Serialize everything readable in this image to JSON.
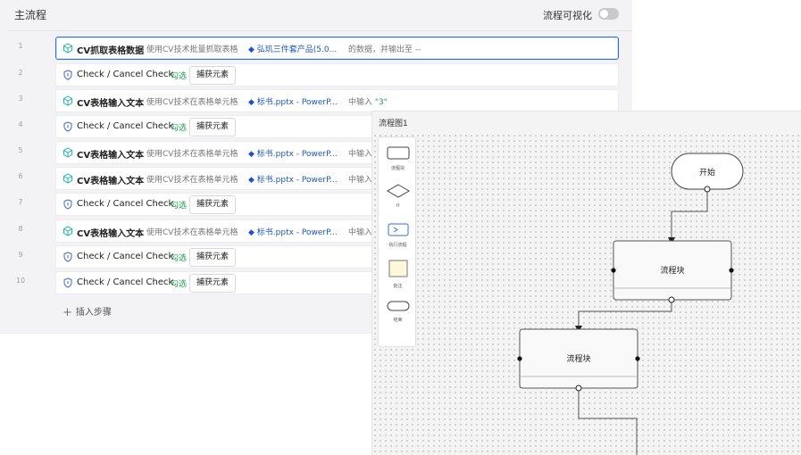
{
  "main": {
    "title": "主流程",
    "visualize_label": "流程可视化",
    "visualize_on": false,
    "insert_step": "插入步骤",
    "rows": [
      {
        "num": "1",
        "kind": "cv",
        "name": "CV抓取表格数据",
        "desc": "使用CV技术批量抓取表格",
        "file": "◆ 弘玑三件套产品(5.0...",
        "tail": "的数据，并输出至 --",
        "selected": true
      },
      {
        "num": "2",
        "kind": "check",
        "name": "Check / Cancel Check",
        "green": "勾选",
        "button": "捕获元素"
      },
      {
        "num": "3",
        "kind": "cv",
        "name": "CV表格输入文本",
        "desc": "使用CV技术在表格单元格",
        "file": "◆ 标书.pptx - PowerP...",
        "tail": "中输入",
        "value": "\"3\""
      },
      {
        "num": "4",
        "kind": "check",
        "name": "Check / Cancel Check",
        "green": "勾选",
        "button": "捕获元素"
      },
      {
        "num": "5",
        "kind": "cv",
        "name": "CV表格输入文本",
        "desc": "使用CV技术在表格单元格",
        "file": "◆ 标书.pptx - PowerP...",
        "tail": "中输入"
      },
      {
        "num": "6",
        "kind": "cv",
        "name": "CV表格输入文本",
        "desc": "使用CV技术在表格单元格",
        "file": "◆ 标书.pptx - PowerP...",
        "tail": "中输入"
      },
      {
        "num": "7",
        "kind": "check",
        "name": "Check / Cancel Check",
        "green": "勾选",
        "button": "捕获元素"
      },
      {
        "num": "8",
        "kind": "cv",
        "name": "CV表格输入文本",
        "desc": "使用CV技术在表格单元格",
        "file": "◆ 标书.pptx - PowerP...",
        "tail": "中输入"
      },
      {
        "num": "9",
        "kind": "check",
        "name": "Check / Cancel Check",
        "green": "勾选",
        "button": "捕获元素"
      },
      {
        "num": "10",
        "kind": "check",
        "name": "Check / Cancel Check",
        "green": "勾选",
        "button": "捕获元素"
      }
    ]
  },
  "diagram": {
    "title": "流程图1",
    "palette": [
      {
        "label": "流程块",
        "icon": "process-block-shape"
      },
      {
        "label": "If",
        "icon": "diamond-shape"
      },
      {
        "label": "执行流程",
        "icon": "terminal-prompt-icon"
      },
      {
        "label": "批注",
        "icon": "note-shape"
      },
      {
        "label": "结束",
        "icon": "end-capsule-shape"
      }
    ],
    "nodes": {
      "start": "开始",
      "block1": "流程块",
      "block2": "流程块"
    }
  },
  "colors": {
    "accent": "#2b6de6",
    "green": "#1f9c4c",
    "link": "#1d55c4",
    "cv_icon": "#1db6b0",
    "check_icon": "#3b63d9"
  }
}
